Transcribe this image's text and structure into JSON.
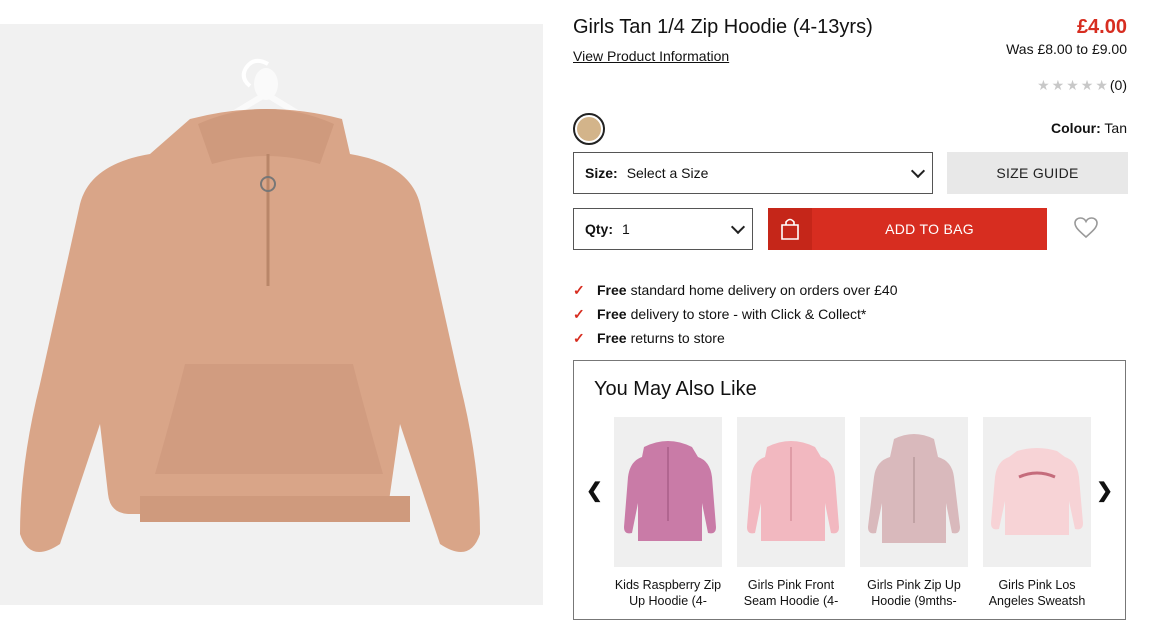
{
  "product": {
    "title": "Girls Tan 1/4 Zip Hoodie (4-13yrs)",
    "view_info_label": "View Product Information",
    "price": "£4.00",
    "was_price": "Was £8.00 to £9.00",
    "rating_count": "(0)",
    "colour_label": "Colour:",
    "colour_value": "Tan",
    "colour_hex": "#d3b48a",
    "image_icon": "tan-hoodie-image"
  },
  "size": {
    "label": "Size:",
    "value": "Select a Size",
    "guide_label": "SIZE GUIDE"
  },
  "qty": {
    "label": "Qty:",
    "value": "1"
  },
  "bag": {
    "add_label": "ADD TO BAG",
    "icon": "shopping-bag-icon"
  },
  "wishlist_icon": "heart-icon",
  "benefits": [
    {
      "bold": "Free",
      "text": "standard home delivery on orders over £40"
    },
    {
      "bold": "Free",
      "text": "delivery to store - with Click & Collect*"
    },
    {
      "bold": "Free",
      "text": "returns to store"
    }
  ],
  "ymal": {
    "title": "You May Also Like",
    "items": [
      {
        "name": "Kids Raspberry Zip Up Hoodie (4-",
        "color": "#c97ba7"
      },
      {
        "name": "Girls Pink Front Seam Hoodie (4-",
        "color": "#f2b8c0"
      },
      {
        "name": "Girls Pink Zip Up Hoodie (9mths-",
        "color": "#d9b9bc"
      },
      {
        "name": "Girls Pink Los Angeles Sweatsh",
        "color": "#f7d3d6"
      }
    ]
  },
  "colors": {
    "accent": "#d72d20",
    "hoodie": "#d9a588"
  }
}
